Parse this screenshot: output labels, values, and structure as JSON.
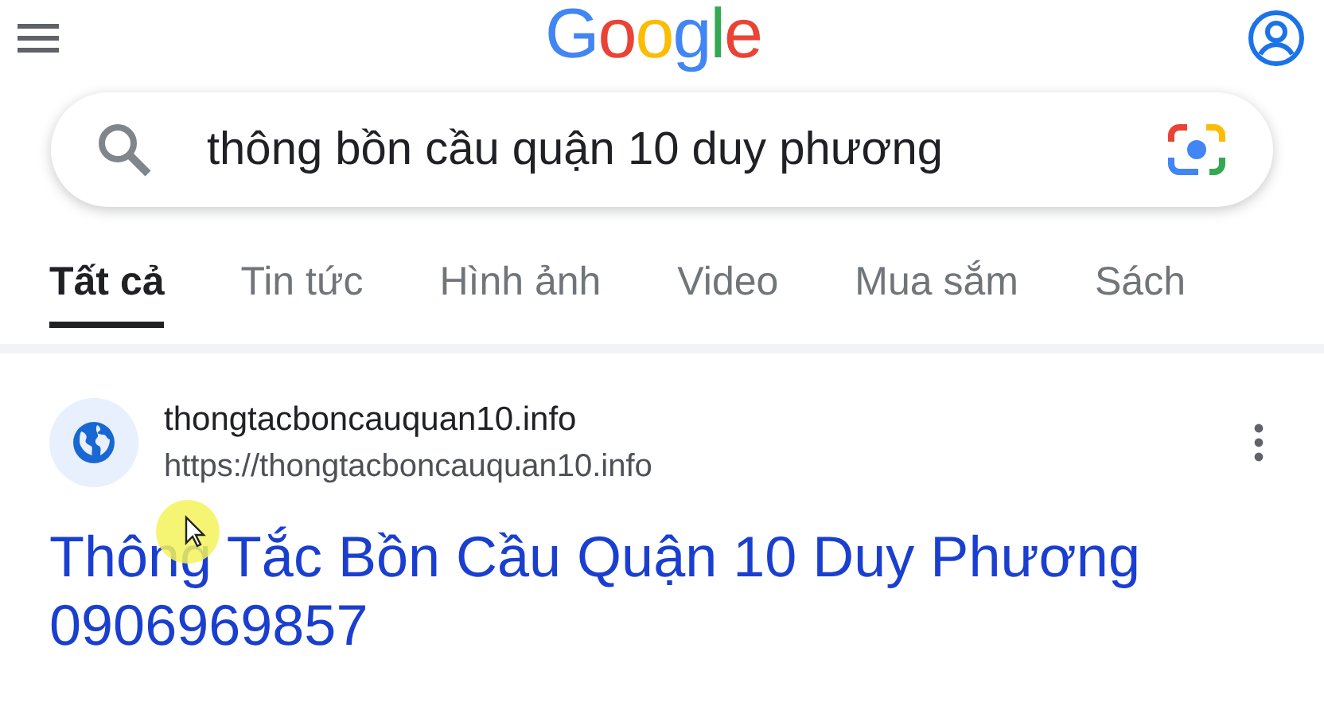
{
  "header": {
    "logo": "Google"
  },
  "search": {
    "value": "thông bồn cầu quận 10 duy phương"
  },
  "tabs": [
    {
      "label": "Tất cả",
      "selected": true
    },
    {
      "label": "Tin tức",
      "selected": false
    },
    {
      "label": "Hình ảnh",
      "selected": false
    },
    {
      "label": "Video",
      "selected": false
    },
    {
      "label": "Mua sắm",
      "selected": false
    },
    {
      "label": "Sách",
      "selected": false
    }
  ],
  "result": {
    "site_name": "thongtacboncauquan10.info",
    "url": "https://thongtacboncauquan10.info",
    "title": "Thông Tắc Bồn Cầu Quận 10 Duy Phương 0906969857"
  }
}
